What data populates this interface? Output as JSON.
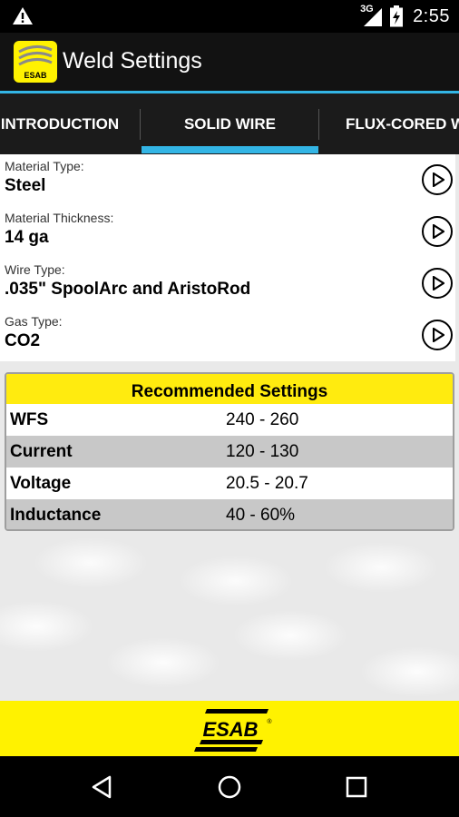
{
  "status_bar": {
    "network": "3G",
    "time": "2:55",
    "icons": [
      "warning-icon",
      "signal-icon",
      "battery-charging-icon"
    ]
  },
  "app_bar": {
    "title": "Weld Settings",
    "logo_text": "ESAB"
  },
  "tabs": [
    {
      "label": "INTRODUCTION",
      "selected": false
    },
    {
      "label": "SOLID WIRE",
      "selected": true
    },
    {
      "label": "FLUX-CORED WI",
      "selected": false
    }
  ],
  "selectors": [
    {
      "label": "Material Type:",
      "value": "Steel",
      "icon": "play-circle-icon"
    },
    {
      "label": "Material Thickness:",
      "value": "14 ga",
      "icon": "play-circle-icon"
    },
    {
      "label": "Wire Type:",
      "value": ".035\" SpoolArc and AristoRod",
      "icon": "play-circle-icon"
    },
    {
      "label": "Gas Type:",
      "value": "CO2",
      "icon": "play-circle-icon"
    }
  ],
  "recommended": {
    "title": "Recommended Settings",
    "rows": [
      {
        "name": "WFS",
        "value": "240 - 260"
      },
      {
        "name": "Current",
        "value": "120 - 130"
      },
      {
        "name": "Voltage",
        "value": "20.5 - 20.7"
      },
      {
        "name": "Inductance",
        "value": "40 - 60%"
      }
    ]
  },
  "footer": {
    "brand": "ESAB",
    "registered": "®"
  },
  "nav_bar": {
    "icons": [
      "back-icon",
      "home-icon",
      "recents-icon"
    ]
  },
  "colors": {
    "accent_blue": "#33b5e5",
    "brand_yellow": "#fff200",
    "header_yellow": "#ffeb0f"
  }
}
